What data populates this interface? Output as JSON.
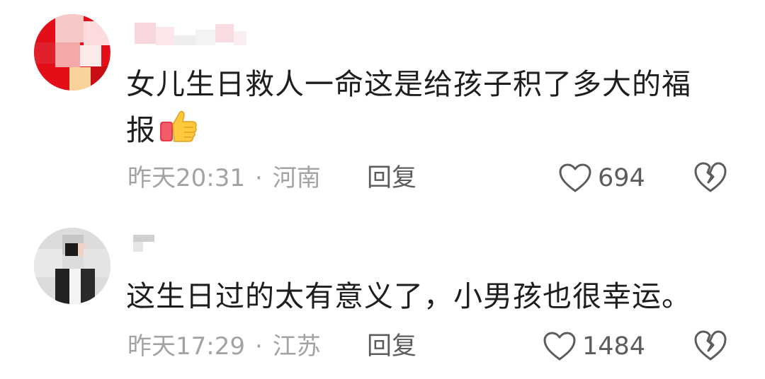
{
  "comments": [
    {
      "avatar_icon": "user-avatar-icon",
      "text_line1": "女儿生日救人一命这是给孩子积了多大的福",
      "text_line2": "报",
      "emoji": "thumbs-up-icon",
      "time": "昨天20:31",
      "separator": "·",
      "location": "河南",
      "reply_label": "回复",
      "like_count": "694"
    },
    {
      "avatar_icon": "user-avatar-icon",
      "text_line1": "这生日过的太有意义了，小男孩也很幸运。",
      "time": "昨天17:29",
      "separator": "·",
      "location": "江苏",
      "reply_label": "回复",
      "like_count": "1484"
    }
  ],
  "colors": {
    "text": "#1e1e1e",
    "meta": "#a3a3a3",
    "action": "#5c5c5c"
  }
}
